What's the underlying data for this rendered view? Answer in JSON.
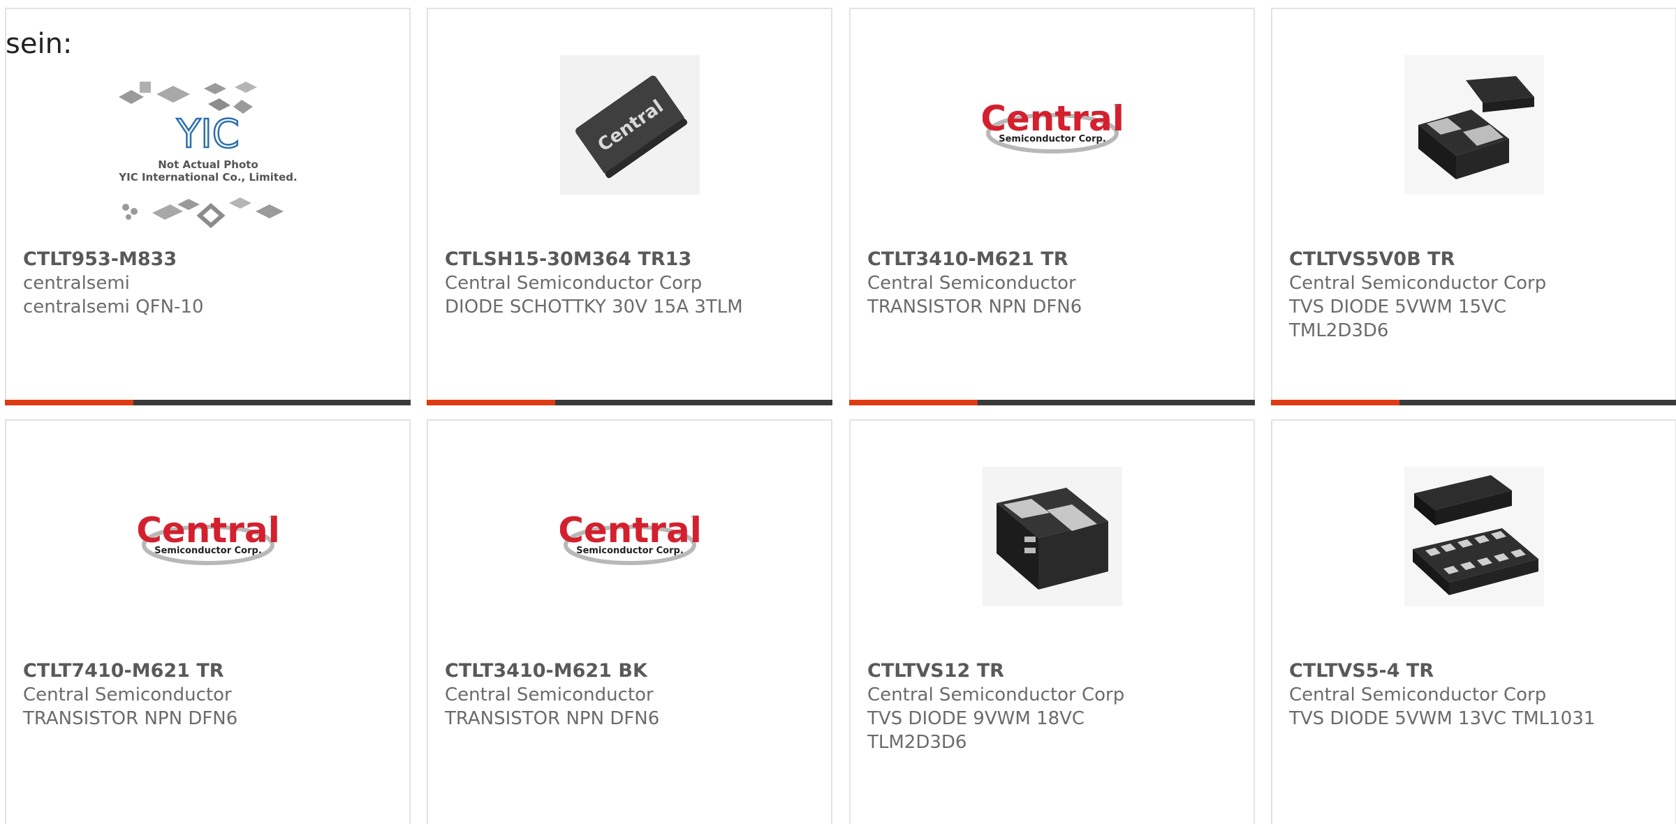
{
  "intro_text": "sein:",
  "colors": {
    "accent": "#e03a12",
    "bar": "#3a3a3a",
    "border": "#e2e2e2",
    "brand_red": "#d4202e"
  },
  "placeholder_image": {
    "line1": "Not Actual Photo",
    "line2": "YIC International Co., Limited.",
    "logo": "YIC"
  },
  "central_logo": {
    "word": "Central",
    "sub": "Semiconductor Corp.",
    "tm": "™"
  },
  "products": [
    {
      "part": "CTLT953-M833",
      "maker": "centralsemi",
      "desc": "centralsemi QFN-10",
      "image": "placeholder-collage"
    },
    {
      "part": "CTLSH15-30M364 TR13",
      "maker": "Central Semiconductor Corp",
      "desc": "DIODE SCHOTTKY 30V 15A 3TLM",
      "image": "chip-central-print"
    },
    {
      "part": "CTLT3410-M621 TR",
      "maker": "Central Semiconductor",
      "desc": "TRANSISTOR NPN DFN6",
      "image": "central-logo"
    },
    {
      "part": "CTLTVS5V0B TR",
      "maker": "Central Semiconductor Corp",
      "desc": "TVS DIODE 5VWM 15VC TML2D3D6",
      "image": "chip-pads-two"
    },
    {
      "part": "CTLT7410-M621 TR",
      "maker": "Central Semiconductor",
      "desc": "TRANSISTOR NPN DFN6",
      "image": "central-logo"
    },
    {
      "part": "CTLT3410-M621 BK",
      "maker": "Central Semiconductor",
      "desc": "TRANSISTOR NPN DFN6",
      "image": "central-logo"
    },
    {
      "part": "CTLTVS12 TR",
      "maker": "Central Semiconductor Corp",
      "desc": "TVS DIODE 9VWM 18VC TLM2D3D6",
      "image": "chip-block"
    },
    {
      "part": "CTLTVS5-4 TR",
      "maker": "Central Semiconductor Corp",
      "desc": "TVS DIODE 5VWM 13VC TML1031",
      "image": "chip-pads-many"
    }
  ]
}
